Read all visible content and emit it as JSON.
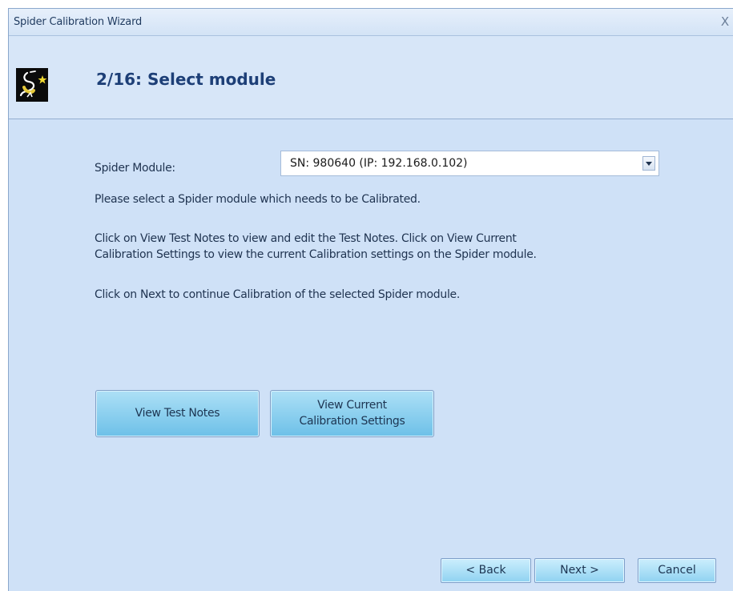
{
  "window": {
    "title": "Spider Calibration Wizard",
    "close_glyph": "X"
  },
  "header": {
    "step_title": "2/16: Select module",
    "logo_icon": "spider-logo-icon"
  },
  "form": {
    "module_label": "Spider Module:",
    "module_value": "SN: 980640 (IP: 192.168.0.102)"
  },
  "instructions": {
    "line1": "Please select a Spider module which needs to be Calibrated.",
    "para2_line1": "Click on View Test Notes to view and edit the Test Notes. Click on View Current",
    "para2_line2": "Calibration Settings to view the current Calibration settings on the Spider module.",
    "line3": "Click on Next to continue Calibration of the selected Spider module."
  },
  "buttons": {
    "view_test_notes": "View Test Notes",
    "view_calibration_line1": "View Current",
    "view_calibration_line2": "Calibration Settings",
    "back": "< Back",
    "next": "Next >",
    "cancel": "Cancel"
  },
  "colors": {
    "window_bg": "#cfe1f7",
    "title_color": "#1d3f77",
    "button_gradient_top": "#ade0f6",
    "button_gradient_bottom": "#6dc0e8"
  }
}
